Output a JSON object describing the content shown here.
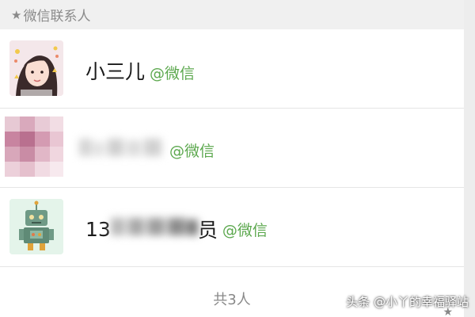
{
  "section": {
    "star_icon": "★",
    "title": "微信联系人"
  },
  "contacts": [
    {
      "name": "小三儿",
      "tag": "@微信",
      "avatar": "girl-photo"
    },
    {
      "name": "",
      "tag": "@微信",
      "avatar": "pixelated-photo"
    },
    {
      "name": "13",
      "name_suffix": "员",
      "tag": "@微信",
      "avatar": "green-robot"
    }
  ],
  "footer": {
    "count_label": "共3人"
  },
  "watermark": {
    "text": "头条 @小丫的幸福驿站"
  },
  "colors": {
    "accent_green": "#5ca84e",
    "header_bg": "#f0f0f0",
    "text_gray": "#888888"
  }
}
